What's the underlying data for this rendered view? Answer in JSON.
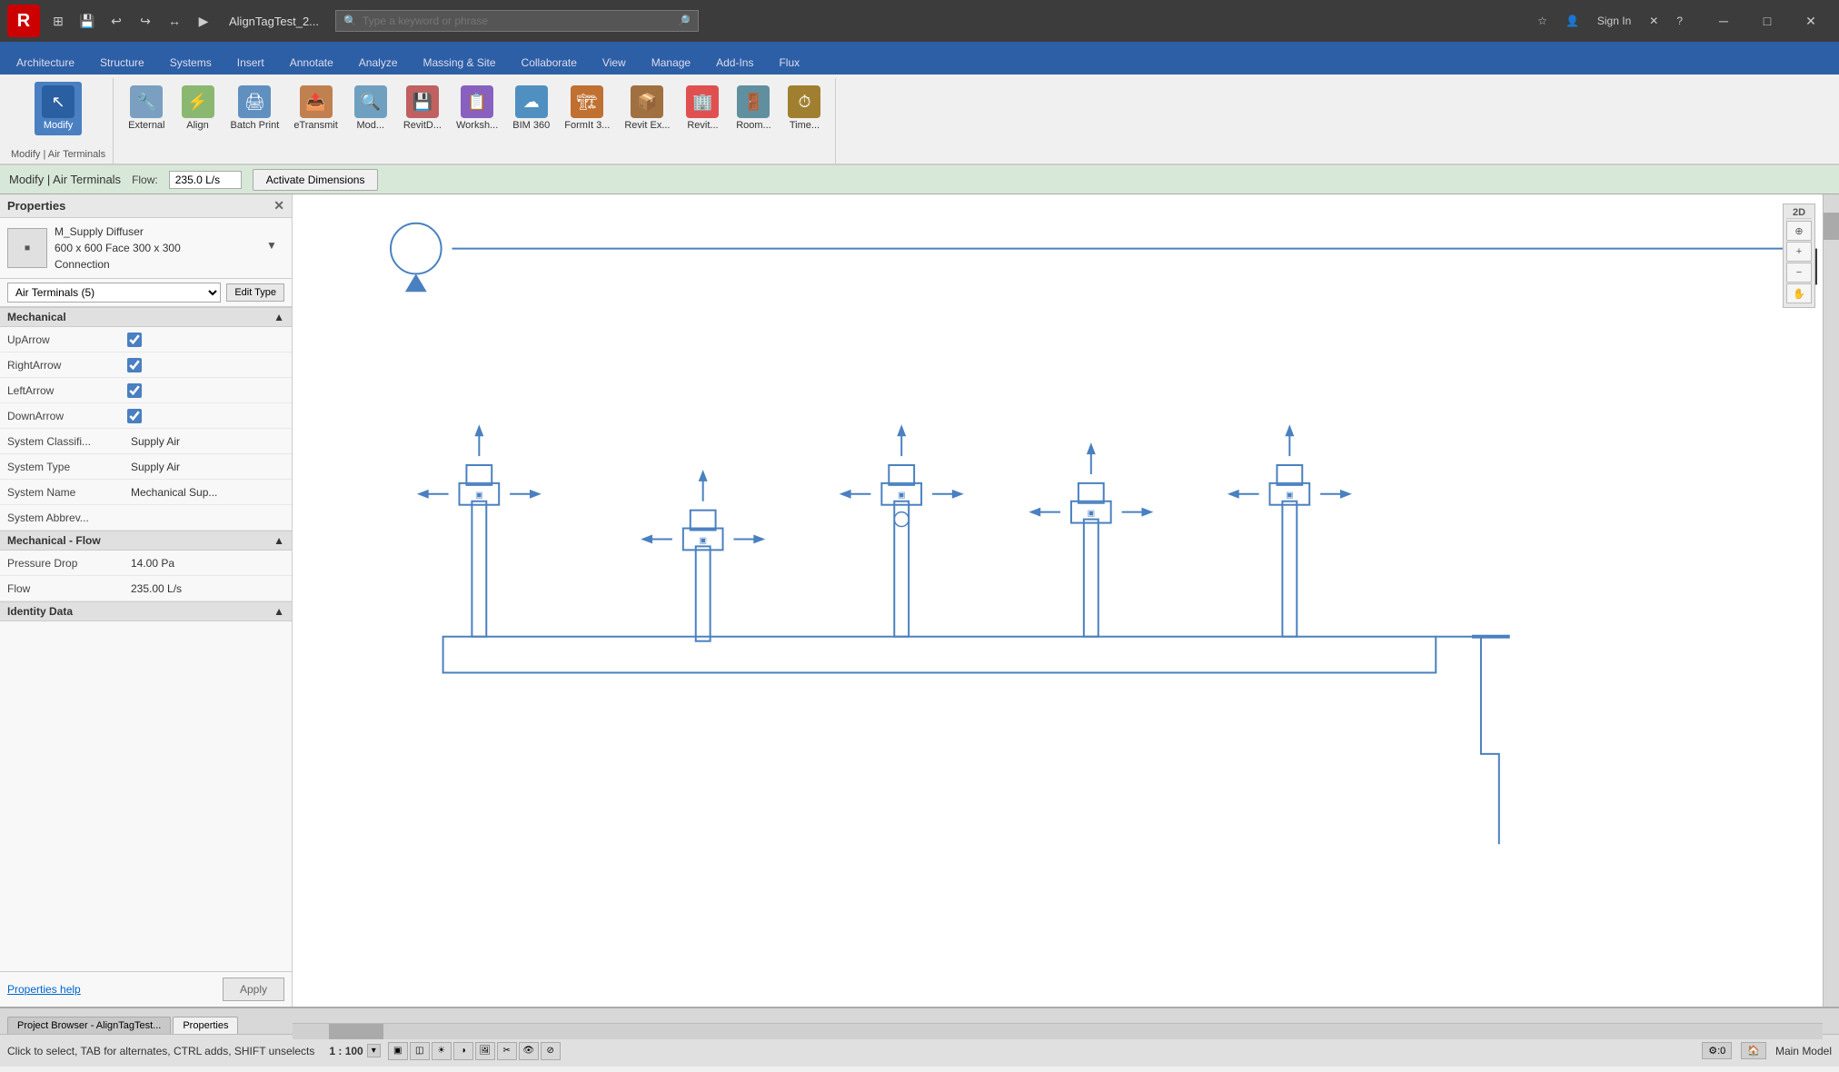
{
  "titlebar": {
    "app_letter": "R",
    "filename": "AlignTagTest_2...",
    "search_placeholder": "Type a keyword or phrase",
    "signin_label": "Sign In",
    "help_label": "?"
  },
  "qat": {
    "buttons": [
      "⊞",
      "💾",
      "↩",
      "↪",
      "↔",
      "▶"
    ]
  },
  "ribbon": {
    "tabs": [
      {
        "label": "Architecture",
        "active": false
      },
      {
        "label": "Structure",
        "active": false
      },
      {
        "label": "Systems",
        "active": false
      },
      {
        "label": "Insert",
        "active": false
      },
      {
        "label": "Annotate",
        "active": false
      },
      {
        "label": "Analyze",
        "active": false
      },
      {
        "label": "Massing & Site",
        "active": false
      },
      {
        "label": "Collaborate",
        "active": false
      },
      {
        "label": "View",
        "active": false
      },
      {
        "label": "Manage",
        "active": false
      },
      {
        "label": "Add-Ins",
        "active": false
      },
      {
        "label": "Flux",
        "active": false
      }
    ],
    "groups": [
      {
        "label": "",
        "items": [
          {
            "icon": "↖",
            "label": "Modify",
            "active": true
          }
        ]
      },
      {
        "label": "",
        "items": [
          {
            "icon": "🔧",
            "label": "External"
          },
          {
            "icon": "⚡",
            "label": "Align"
          },
          {
            "icon": "🖨",
            "label": "Batch Print"
          },
          {
            "icon": "📤",
            "label": "eTransmit"
          },
          {
            "icon": "🔍",
            "label": "Mod..."
          },
          {
            "icon": "💾",
            "label": "RevitD..."
          },
          {
            "icon": "📋",
            "label": "Worksh..."
          },
          {
            "icon": "☁",
            "label": "BIM 360"
          },
          {
            "icon": "🏗",
            "label": "FormIt 3..."
          },
          {
            "icon": "📦",
            "label": "Revit Ex..."
          },
          {
            "icon": "🏢",
            "label": "Revit..."
          },
          {
            "icon": "🚪",
            "label": "Room..."
          },
          {
            "icon": "⏱",
            "label": "Time..."
          }
        ]
      }
    ]
  },
  "contextbar": {
    "modify_label": "Modify | Air Terminals",
    "flow_label": "Flow:",
    "flow_value": "235.0 L/s",
    "activate_label": "Activate Dimensions"
  },
  "properties": {
    "title": "Properties",
    "type_name": "M_Supply Diffuser",
    "type_sub": "600 x 600 Face 300 x 300",
    "type_sub2": "Connection",
    "selector_value": "Air Terminals (5)",
    "edit_type_label": "Edit Type",
    "sections": [
      {
        "label": "Mechanical",
        "rows": [
          {
            "label": "UpArrow",
            "type": "checkbox",
            "checked": true
          },
          {
            "label": "RightArrow",
            "type": "checkbox",
            "checked": true
          },
          {
            "label": "LeftArrow",
            "type": "checkbox",
            "checked": true
          },
          {
            "label": "DownArrow",
            "type": "checkbox",
            "checked": true
          },
          {
            "label": "System Classifi...",
            "type": "text",
            "value": "Supply Air"
          },
          {
            "label": "System Type",
            "type": "text",
            "value": "Supply Air"
          },
          {
            "label": "System Name",
            "type": "text",
            "value": "Mechanical Sup..."
          },
          {
            "label": "System Abbrev...",
            "type": "text",
            "value": ""
          }
        ]
      },
      {
        "label": "Mechanical - Flow",
        "rows": [
          {
            "label": "Pressure Drop",
            "type": "text",
            "value": "14.00 Pa"
          },
          {
            "label": "Flow",
            "type": "text",
            "value": "235.00 L/s"
          }
        ]
      },
      {
        "label": "Identity Data",
        "rows": []
      }
    ],
    "help_link": "Properties help",
    "apply_label": "Apply"
  },
  "statusbar": {
    "message": "Click to select, TAB for alternates, CTRL adds, SHIFT unselects",
    "scale": "1 : 100",
    "model_label": "Main Model"
  },
  "bottombar": {
    "tabs": [
      {
        "label": "Project Browser - AlignTagTest...",
        "active": false
      },
      {
        "label": "Properties",
        "active": false
      }
    ]
  }
}
